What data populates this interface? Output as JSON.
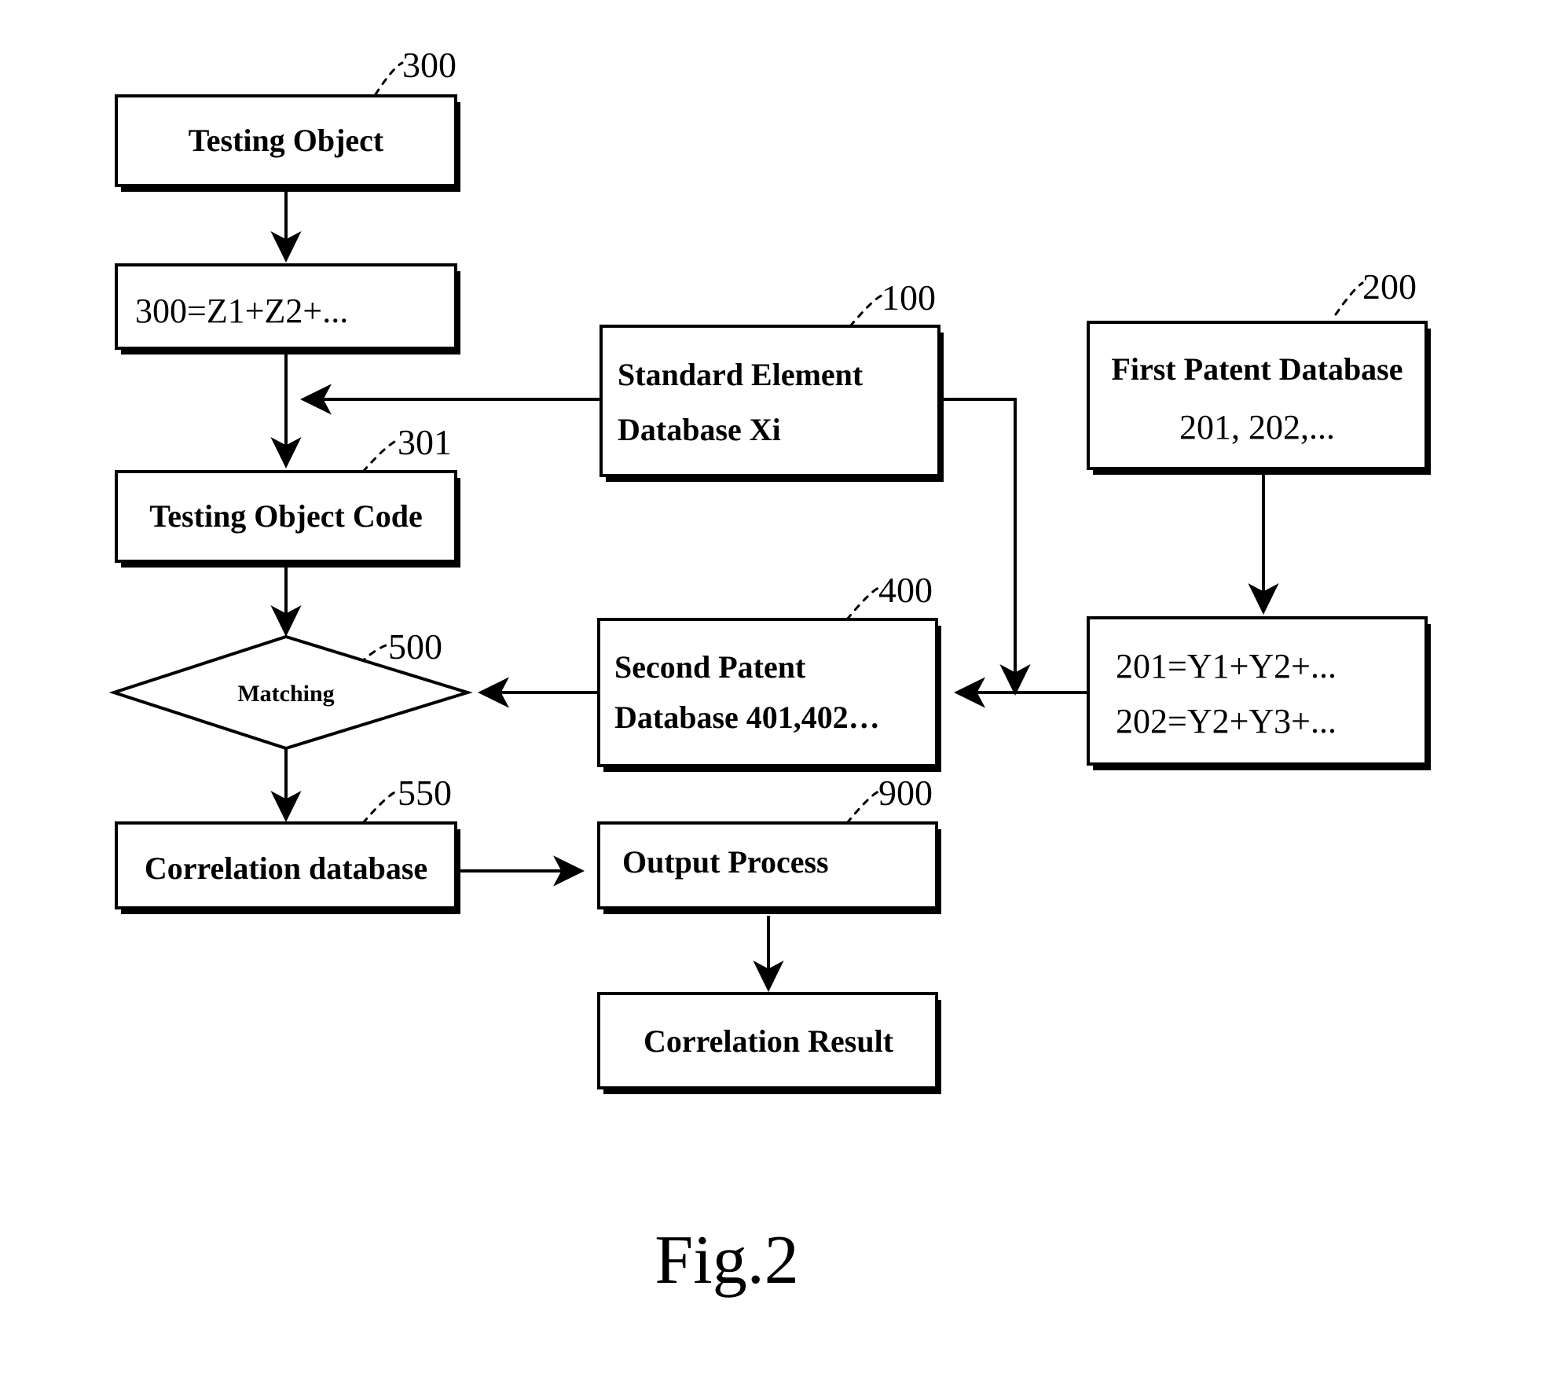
{
  "figure": {
    "caption": "Fig.2",
    "type": "patent-flowchart"
  },
  "nodes": {
    "testing_object": {
      "label": "Testing Object",
      "ref": "300",
      "shape": "rectangle"
    },
    "testing_object_formula": {
      "label": "300=Z1+Z2+...",
      "shape": "rectangle"
    },
    "testing_object_code": {
      "label": "Testing Object  Code",
      "ref": "301",
      "shape": "rectangle"
    },
    "matching": {
      "label": "Matching",
      "ref": "500",
      "shape": "diamond"
    },
    "correlation_database": {
      "label": "Correlation database",
      "ref": "550",
      "shape": "rectangle"
    },
    "standard_element_database": {
      "label_line1": "Standard Element",
      "label_line2": "Database     Xi",
      "ref": "100",
      "shape": "rectangle"
    },
    "second_patent_database": {
      "label_line1": "Second    Patent",
      "label_line2": "Database    401,402…",
      "ref": "400",
      "shape": "rectangle"
    },
    "output_process": {
      "label": "Output Process",
      "ref": "900",
      "shape": "rectangle"
    },
    "correlation_result": {
      "label": "Correlation Result",
      "shape": "rectangle"
    },
    "first_patent_database": {
      "label_line1": "First Patent Database",
      "label_line2": "201, 202,...",
      "ref": "200",
      "shape": "rectangle"
    },
    "patent_formulas": {
      "label_line1": "201=Y1+Y2+...",
      "label_line2": "202=Y2+Y3+...",
      "shape": "rectangle"
    }
  },
  "colors": {
    "line": "#000000",
    "fill": "#ffffff",
    "text": "#000000"
  }
}
